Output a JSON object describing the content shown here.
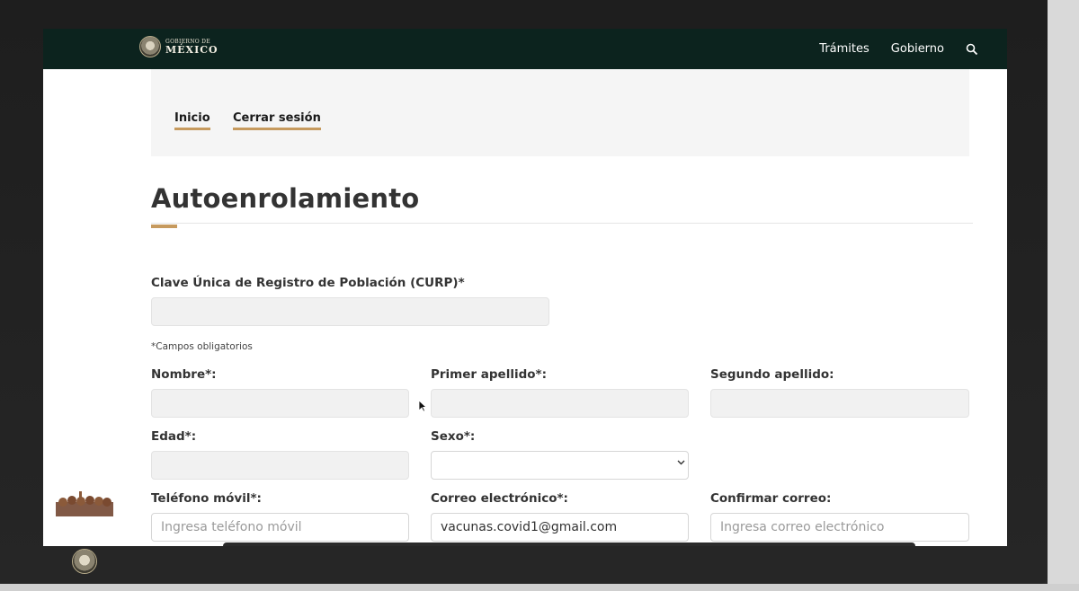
{
  "header": {
    "logo_top": "GOBIERNO DE",
    "logo_main": "MÉXICO",
    "nav": [
      "Trámites",
      "Gobierno"
    ],
    "search_icon": "search-icon"
  },
  "subnav": {
    "links": [
      "Inicio",
      "Cerrar sesión"
    ]
  },
  "page": {
    "title": "Autoenrolamiento"
  },
  "form": {
    "curp_label": "Clave Única de Registro de Población (CURP)*",
    "required_note": "*Campos obligatorios",
    "nombre_label": "Nombre*:",
    "primer_apellido_label": "Primer apellido*:",
    "segundo_apellido_label": "Segundo apellido:",
    "edad_label": "Edad*:",
    "sexo_label": "Sexo*:",
    "telefono_label": "Teléfono móvil*:",
    "telefono_placeholder": "Ingresa teléfono móvil",
    "correo_label": "Correo electrónico*:",
    "correo_value": "vacunas.covid1@gmail.com",
    "confirmar_label": "Confirmar correo:",
    "confirmar_placeholder": "Ingresa correo electrónico"
  },
  "colors": {
    "header_bg": "#0c231e",
    "accent": "#c69a5e"
  }
}
